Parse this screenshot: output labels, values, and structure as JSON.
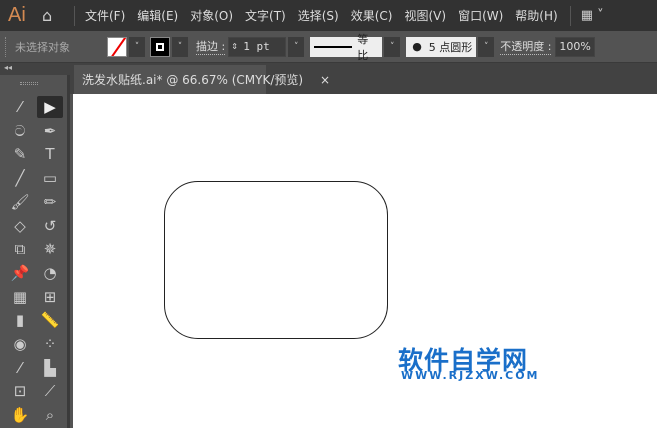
{
  "app": {
    "logo": "Ai",
    "home_icon": "home-icon"
  },
  "menu": [
    "文件(F)",
    "编辑(E)",
    "对象(O)",
    "文字(T)",
    "选择(S)",
    "效果(C)",
    "视图(V)",
    "窗口(W)",
    "帮助(H)"
  ],
  "control": {
    "selection": "未选择对象",
    "stroke_label": "描边 :",
    "stroke_value": "1 pt",
    "profile": "等比",
    "brush": "5 点圆形",
    "opacity_label": "不透明度 :",
    "opacity_value": "100%"
  },
  "document": {
    "tab_title": "洗发水贴纸.ai* @ 66.67% (CMYK/预览)",
    "close": "×"
  },
  "panel": {
    "collapse": "◂◂"
  },
  "tools": [
    "magic-wand",
    "selection",
    "lasso",
    "pen",
    "curvature",
    "type",
    "line-segment",
    "rectangle",
    "paintbrush",
    "pencil",
    "eraser",
    "rotate",
    "free-transform",
    "puppet-warp",
    "pin",
    "shape-builder",
    "perspective-grid",
    "mesh",
    "gradient",
    "ruler",
    "blend",
    "symbol-sprayer",
    "eyedropper",
    "column-graph",
    "artboard",
    "slice",
    "hand",
    "zoom"
  ],
  "watermark": {
    "text": "软件自学网",
    "url": "WWW.RJZXW.COM"
  },
  "colors": {
    "accent": "#1a6fc9",
    "logo": "#d48a52"
  }
}
